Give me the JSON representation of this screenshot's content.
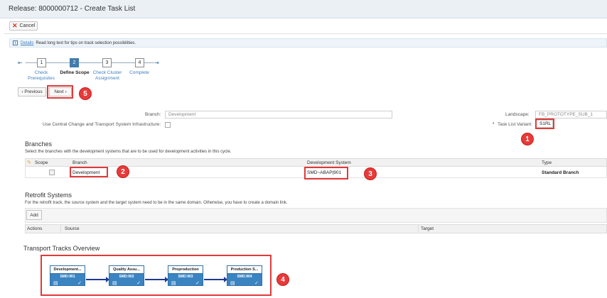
{
  "window": {
    "title": "Release: 8000000712 - Create Task List"
  },
  "toolbar": {
    "cancel_label": "Cancel"
  },
  "info": {
    "link": "Details",
    "text": "Read long text for tips on track selection possibilities."
  },
  "roadmap": {
    "steps": [
      {
        "number": "1",
        "label_line1": "Check",
        "label_line2": "Prerequisites"
      },
      {
        "number": "2",
        "label_line1": "Define Scope",
        "label_line2": ""
      },
      {
        "number": "3",
        "label_line1": "Check Cluster",
        "label_line2": "Assignment"
      },
      {
        "number": "4",
        "label_line1": "Complete",
        "label_line2": ""
      }
    ],
    "active_step": 2
  },
  "nav": {
    "previous_label": "‹ Previous",
    "next_label": "Next ›"
  },
  "form": {
    "branch_label": "Branch:",
    "branch_value": "Development",
    "use_cts_label": "Use Central Change and Transport System Infrastructure:",
    "landscape_label": "Landscape:",
    "landscape_value": "FB_PROTOTYPE_SUB_1",
    "variant_label": "Task List Variant:",
    "variant_value": "S1RL"
  },
  "branches": {
    "title": "Branches",
    "description": "Select the branches with the development systems that are to be used for development activities in this cycle.",
    "headers": [
      "Scope",
      "Branch",
      "Development System",
      "Type"
    ],
    "rows": [
      {
        "branch": "Development",
        "system": "SMD~ABAP|901",
        "type": "Standard Branch"
      }
    ]
  },
  "retrofit": {
    "title": "Retrofit Systems",
    "description": "For the retrofit track, the source system and the target system need to be in the same domain. Otherwise, you have to create a domain link.",
    "add_label": "Add",
    "headers": [
      "Actions",
      "Source",
      "Target"
    ]
  },
  "tracks": {
    "title": "Transport Tracks Overview",
    "items": [
      {
        "name": "Development...",
        "system": "SMD:901"
      },
      {
        "name": "Quality Assu...",
        "system": "SMD:902"
      },
      {
        "name": "Preproduction",
        "system": "SMD:903"
      },
      {
        "name": "Production S...",
        "system": "SMD:904"
      }
    ]
  },
  "callouts": [
    "1",
    "2",
    "3",
    "4",
    "5"
  ],
  "colors": {
    "accent": "#427cac",
    "callout": "#e83a3a",
    "track_fill": "#3a84c2",
    "track_arrow": "#1f3a94"
  }
}
